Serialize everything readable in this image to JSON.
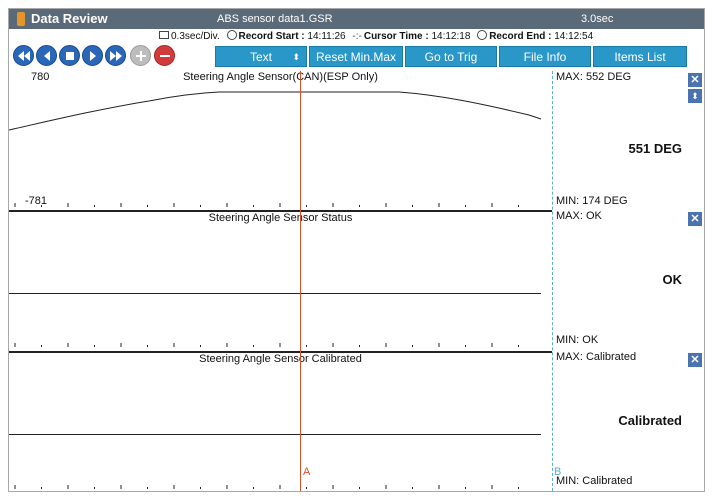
{
  "titlebar": {
    "title": "Data Review",
    "file": "ABS sensor data1.GSR",
    "timespan": "3.0sec"
  },
  "info": {
    "div": "0.3sec/Div.",
    "record_start_label": "Record Start :",
    "record_start": "14:11:26",
    "cursor_time_label": "Cursor Time :",
    "cursor_time": "14:12:18",
    "record_end_label": "Record End :",
    "record_end": "14:12:54"
  },
  "toolbar": {
    "text_select": "Text",
    "reset_minmax": "Reset Min.Max",
    "go_to_trig": "Go to Trig",
    "file_info": "File Info",
    "items_list": "Items List"
  },
  "panels": [
    {
      "title": "Steering Angle Sensor(CAN)(ESP Only)",
      "axis_max": "780",
      "axis_min": "-781",
      "max": "MAX:  552 DEG",
      "min": "MIN:  174 DEG",
      "current": "551 DEG"
    },
    {
      "title": "Steering Angle Sensor Status",
      "max": "MAX: OK",
      "min": "MIN: OK",
      "current": "OK"
    },
    {
      "title": "Steering Angle Sensor Calibrated",
      "max": "MAX: Calibrated",
      "min": "MIN: Calibrated",
      "current": "Calibrated"
    }
  ],
  "cursors": {
    "a": "A",
    "b": "B"
  },
  "icons": {
    "first": "skip-back-icon",
    "prev": "step-back-icon",
    "stop": "stop-icon",
    "next": "step-forward-icon",
    "last": "skip-forward-icon",
    "zoom_in": "plus-icon",
    "zoom_out": "minus-icon",
    "close": "close-icon",
    "arrange": "up-down-icon"
  },
  "colors": {
    "titlebar": "#5b6a78",
    "button": "#2a97c9",
    "nav": "#2b67b8",
    "cursor_a": "#d9532a",
    "cursor_b": "#5aaec7"
  }
}
